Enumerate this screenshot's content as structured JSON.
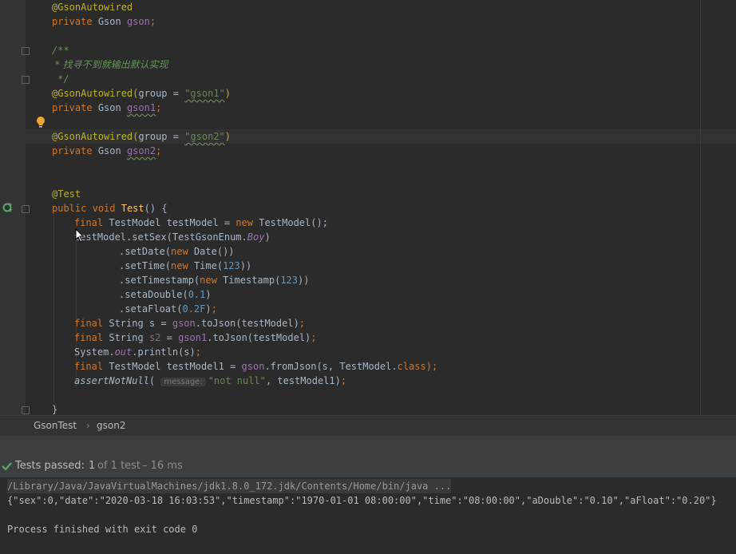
{
  "editor": {
    "lines": {
      "l1_ann": "@GsonAutowired",
      "l2_kw": "private",
      "l2_type": "Gson",
      "l2_field": "gson",
      "l4": "/**",
      "l5": " * 找寻不到就输出默认实现",
      "l6": " */",
      "l7_ann": "@GsonAutowired",
      "l7_param": "group",
      "l7_str": "\"gson1\"",
      "l8_kw": "private",
      "l8_type": "Gson",
      "l8_field": "gson1",
      "l10_ann": "@GsonAutowired",
      "l10_param": "group",
      "l10_str": "\"gson2\"",
      "l11_kw": "private",
      "l11_type": "Gson",
      "l11_field": "gson2",
      "l14_ann": "@Test",
      "l15_kw1": "public",
      "l15_kw2": "void",
      "l15_fn": "Test",
      "l16_kw": "final",
      "l16_decl": "TestModel testModel = ",
      "l16_new": "new",
      "l16_rest": "TestModel();",
      "l17_a": "testModel.setSex(TestGsonEnum.",
      "l17_boy": "Boy",
      "l18_a": ".setDate(",
      "l18_new": "new",
      "l18_b": "Date())",
      "l19_a": ".setTime(",
      "l19_new": "new",
      "l19_b": "Time(",
      "l19_num": "123",
      "l20_a": ".setTimestamp(",
      "l20_new": "new",
      "l20_b": "Timestamp(",
      "l20_num": "123",
      "l21_a": ".setaDouble(",
      "l21_num": "0.1",
      "l22_a": ".setaFloat(",
      "l22_num": "0.2F",
      "l23_kw": "final",
      "l23_decl": "String s = ",
      "l23_field": "gson",
      "l23_rest": ".toJson(testModel)",
      "l24_kw": "final",
      "l24_type": "String",
      "l24_var": "s2",
      "l24_field": "gson1",
      "l24_rest": ".toJson(testModel)",
      "l25_a": "System.",
      "l25_out": "out",
      "l25_b": ".println(s)",
      "l26_kw": "final",
      "l26_decl": "TestModel testModel1 = ",
      "l26_field": "gson",
      "l26_mid": ".fromJson(s, TestModel.",
      "l26_class": "class",
      "l26_end": ");",
      "l27_fn": "assertNotNull",
      "l27_hint": "message:",
      "l27_str": "\"not null\"",
      "l27_rest": ", testModel1)",
      "l29": "}"
    }
  },
  "breadcrumb": {
    "items": [
      "GsonTest",
      "gson2"
    ],
    "separator": "›"
  },
  "status": {
    "passed_label": "Tests passed:",
    "passed_count": "1",
    "of_total": "of 1 test",
    "duration": "– 16 ms"
  },
  "console": {
    "cmd": "/Library/Java/JavaVirtualMachines/jdk1.8.0_172.jdk/Contents/Home/bin/java ...",
    "json": "{\"sex\":0,\"date\":\"2020-03-18 16:03:53\",\"timestamp\":\"1970-01-01 08:00:00\",\"time\":\"08:00:00\",\"aDouble\":\"0.10\",\"aFloat\":\"0.20\"}",
    "exit": "Process finished with exit code 0"
  },
  "colors": {
    "accent_pass": "#59a869",
    "bulb": "#f0a732",
    "run_icon": "#59a869"
  },
  "icons": [
    "bulb-icon",
    "run-test-icon",
    "check-icon",
    "mouse-cursor-icon",
    "fold-marker-icon"
  ]
}
